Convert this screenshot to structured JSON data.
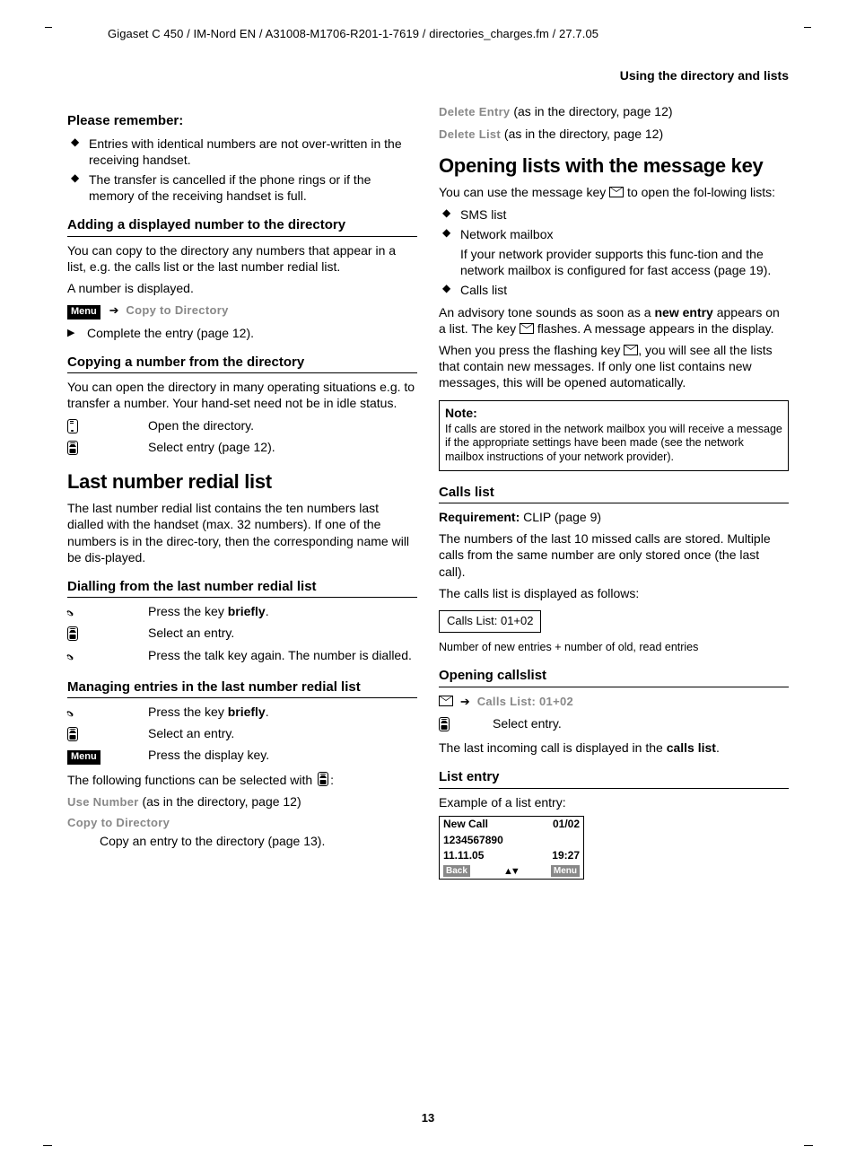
{
  "header": "Gigaset C 450 / IM-Nord EN / A31008-M1706-R201-1-7619 / directories_charges.fm / 27.7.05",
  "section_header": "Using the directory and lists",
  "page_number": "13",
  "col1": {
    "remember_h": "Please remember:",
    "remember_items": [
      "Entries with identical numbers are not over-written in the receiving handset.",
      "The transfer is cancelled if the phone rings or if the memory of the receiving handset is full."
    ],
    "add_h": "Adding a displayed number to the directory",
    "add_p": "You can copy to the directory any numbers that appear in a list, e.g. the calls list or the last number redial list.",
    "add_p2": "A number is displayed.",
    "menu_label": "Menu",
    "copy_to_dir": "Copy to Directory",
    "complete_entry": "Complete the entry (page 12).",
    "copy_h": "Copying a number from the directory",
    "copy_p": "You can open the directory in many operating situations e.g. to transfer a number. Your hand-set need not be in idle status.",
    "copy_r1": "Open the directory.",
    "copy_r2": "Select entry (page 12).",
    "h1a": "Last number redial list",
    "lnr_p": "The last number redial list contains the ten numbers last dialled with the handset (max. 32 numbers). If one of the numbers is in the direc-tory, then the corresponding name will be dis-played.",
    "dial_h": "Dialling from the last number redial list",
    "dial_r1a": "Press the key ",
    "dial_r1b": "briefly",
    "dial_r1c": ".",
    "dial_r2": "Select an entry.",
    "dial_r3": "Press the talk key again. The number is dialled.",
    "man_h": "Managing entries in the last number redial list",
    "man_r1a": "Press the key ",
    "man_r1b": "briefly",
    "man_r1c": ".",
    "man_r2": "Select an entry.",
    "man_r3": "Press the display key.",
    "man_p": "The following functions can be selected with",
    "man_colon": ":",
    "use_number": "Use Number",
    "use_number_tail": "  (as in the directory, page 12)",
    "copy_dir2": "Copy to Directory",
    "copy_dir2_p": "Copy an entry to the directory (page 13)."
  },
  "col2": {
    "del_entry": "Delete Entry",
    "del_entry_tail": "  (as in the directory, page 12)",
    "del_list": "Delete List",
    "del_list_tail": " (as in the directory, page 12)",
    "h1b": "Opening lists with the message key",
    "msg_p1a": "You can use the message key ",
    "msg_p1b": " to open the fol-lowing lists:",
    "msg_items": {
      "i1": "SMS list",
      "i2": "Network mailbox",
      "i2b": "If your network provider supports this func-tion and the network mailbox is configured for fast access (page 19).",
      "i3": "Calls list"
    },
    "adv_a": "An advisory tone sounds as soon as a ",
    "adv_b": "new entry",
    "adv_c": " appears on a list. The key ",
    "adv_d": " flashes. A message appears in the display.",
    "press_a": "When you press the flashing key ",
    "press_b": ", you will see all the lists that contain new messages. If only one list contains new messages, this will be opened automatically.",
    "note_h": "Note:",
    "note_b": "If calls are stored in the network mailbox you will receive a message if the appropriate settings have been made (see the network mailbox instructions of your network provider).",
    "calls_h": "Calls list",
    "req_a": "Requirement:",
    "req_b": " CLIP (page 9)",
    "calls_p": "The numbers of the last 10 missed calls are stored. Multiple calls from the same number are only stored once (the last call).",
    "calls_p2": "The calls list is displayed as follows:",
    "calls_box": "Calls List:  01+02",
    "calls_cap": "Number of new entries + number of old, read entries",
    "open_h": "Opening callslist",
    "open_nav": "Calls List:  01+02",
    "open_r": "Select entry.",
    "open_p_a": "The last incoming call is displayed in the ",
    "open_p_b": "calls list",
    "open_p_c": ".",
    "le_h": "List entry",
    "le_p": "Example of a list entry:",
    "display": {
      "r1a": "New Call",
      "r1b": "01/02",
      "r2": "1234567890",
      "r3a": "11.11.05",
      "r3b": "19:27",
      "back": "Back",
      "menu": "Menu"
    }
  }
}
